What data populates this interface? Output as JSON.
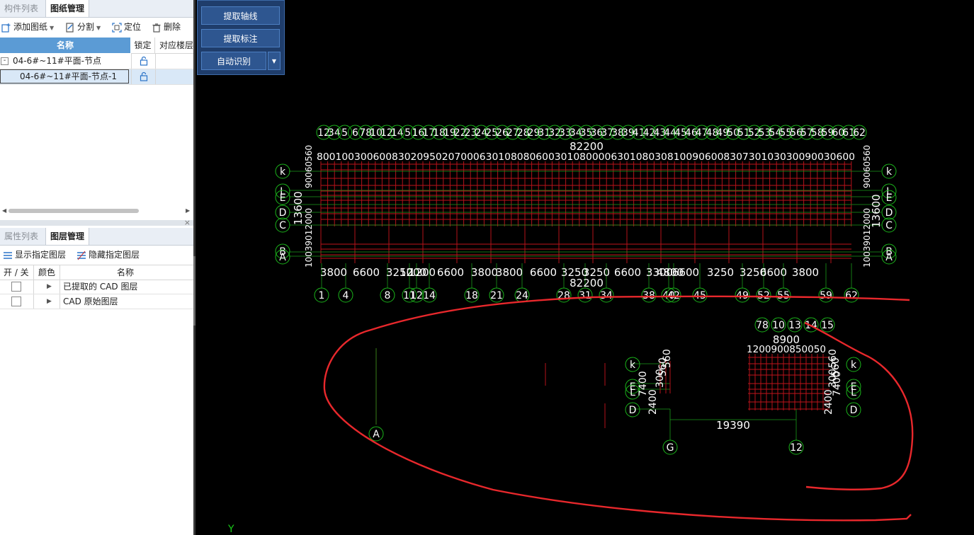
{
  "left_panel": {
    "top_tabs": [
      "构件列表",
      "图纸管理"
    ],
    "toolbar": {
      "add": "添加图纸",
      "split": "分割",
      "locate": "定位",
      "delete": "删除"
    },
    "grid": {
      "headers": {
        "name": "名称",
        "lock": "锁定",
        "floor": "对应楼层"
      },
      "rows": [
        {
          "name": "04-6#~11#平面-节点",
          "expander": "-"
        },
        {
          "name": "04-6#~11#平面-节点-1"
        }
      ]
    },
    "bottom_tabs": [
      "属性列表",
      "图层管理"
    ],
    "close_glyph": "×",
    "layer_toolbar": {
      "show": "显示指定图层",
      "hide": "隐藏指定图层"
    },
    "layer_table": {
      "headers": {
        "onoff": "开 / 关",
        "color": "颜色",
        "name": "名称"
      },
      "rows": [
        {
          "name": "已提取的 CAD 图层"
        },
        {
          "name": "CAD 原始图层"
        }
      ]
    }
  },
  "float_panel": {
    "extract_axis": "提取轴线",
    "extract_dim": "提取标注",
    "auto_recognize": "自动识别"
  },
  "cad": {
    "ucs_label": "Y",
    "top_plan": {
      "top_dim_total": "82200",
      "top_dim_chain": "80010030060083020950207000630108080600301080000630108030810090600830730103030090030600",
      "top_axis_numbers": [
        "12",
        "34",
        "5",
        "6",
        "78",
        "10",
        "12",
        "14",
        "5",
        "16",
        "17",
        "18",
        "19",
        "22",
        "23",
        "24",
        "25",
        "26",
        "27",
        "28",
        "29",
        "31",
        "32",
        "33",
        "34",
        "35",
        "36",
        "37",
        "38",
        "39",
        "41",
        "42",
        "43",
        "44",
        "45",
        "46",
        "47",
        "48",
        "49",
        "50",
        "51",
        "52",
        "53",
        "54",
        "55",
        "56",
        "57",
        "58",
        "59",
        "60",
        "61",
        "62"
      ],
      "left_dim_stack": "90060560",
      "left_dim_total": "13600",
      "left_dim_stack_lower": "10039012000",
      "right_dim_stack": "90060560",
      "right_dim_total": "13600",
      "right_dim_stack_lower": "10039012000",
      "row_axes_left": [
        "k",
        "L",
        "E",
        "D",
        "C",
        "B",
        "A"
      ],
      "row_axes_right": [
        "k",
        "L",
        "E",
        "D",
        "C",
        "B",
        "A"
      ],
      "bottom_dims": [
        "3800",
        "6600",
        "3250",
        "1200",
        "1200",
        "6600",
        "3800",
        "3800",
        "6600",
        "3250",
        "3250",
        "6600",
        "3300",
        "4800",
        "6600",
        "3250",
        "3250",
        "6600",
        "3800"
      ],
      "bottom_total": "82200",
      "bottom_axes": [
        "1",
        "4",
        "8",
        "11",
        "12",
        "14",
        "18",
        "21",
        "24",
        "28",
        "31",
        "34",
        "38",
        "40",
        "42",
        "45",
        "49",
        "52",
        "55",
        "59",
        "62"
      ]
    },
    "detail": {
      "top_axes": [
        "78",
        "10",
        "13",
        "14",
        "15"
      ],
      "top_total": "8900",
      "top_chain": "1200900850050",
      "left_axes": [
        "k",
        "E",
        "L",
        "D"
      ],
      "right_axes": [
        "k",
        "E",
        "L",
        "D"
      ],
      "left_vdims": [
        "7400",
        "2400",
        "300",
        "560",
        "560"
      ],
      "right_vdims": [
        "7400",
        "2400",
        "300",
        "560",
        "560"
      ],
      "span_dim": "19390",
      "bottom_axes": [
        "G",
        "12"
      ],
      "lone_axis": "A"
    }
  }
}
